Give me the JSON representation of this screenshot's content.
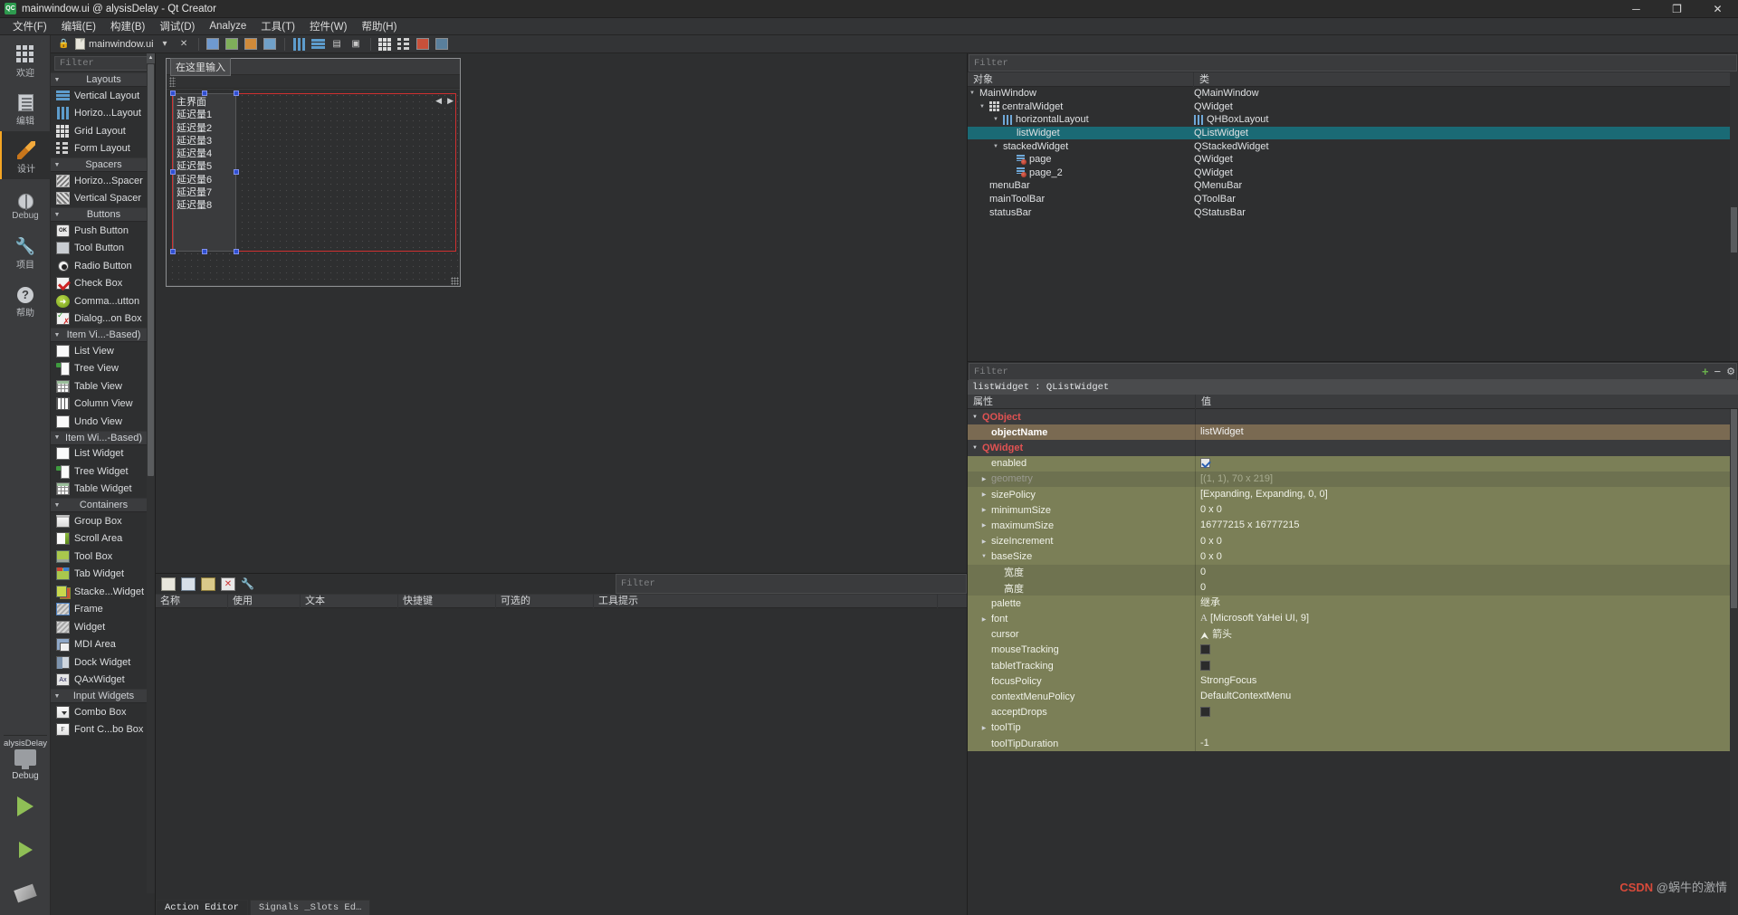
{
  "window": {
    "title": "mainwindow.ui @ alysisDelay - Qt Creator",
    "app_badge": "QC",
    "minimize": "─",
    "maximize": "❐",
    "close": "✕"
  },
  "menubar": [
    {
      "label": "文件(F)"
    },
    {
      "label": "编辑(E)"
    },
    {
      "label": "构建(B)"
    },
    {
      "label": "调试(D)"
    },
    {
      "label": "Analyze"
    },
    {
      "label": "工具(T)"
    },
    {
      "label": "控件(W)"
    },
    {
      "label": "帮助(H)"
    }
  ],
  "modebar": {
    "items": [
      {
        "label": "欢迎",
        "icon": "grid-icon",
        "active": false
      },
      {
        "label": "编辑",
        "icon": "document-icon",
        "active": false
      },
      {
        "label": "设计",
        "icon": "pencil-icon",
        "active": true
      },
      {
        "label": "Debug",
        "icon": "bug-icon",
        "active": false
      },
      {
        "label": "项目",
        "icon": "wrench-icon",
        "active": false
      },
      {
        "label": "帮助",
        "icon": "question-icon",
        "active": false
      }
    ],
    "kit": {
      "project": "alysisDelay",
      "build_config": "Debug"
    }
  },
  "filebar": {
    "filename": "mainwindow.ui"
  },
  "widgetbox": {
    "filter_placeholder": "Filter",
    "groups": [
      {
        "title": "Layouts",
        "items": [
          {
            "label": "Vertical Layout",
            "icon": "vertical-layout-icon"
          },
          {
            "label": "Horizo...Layout",
            "icon": "horizontal-layout-icon"
          },
          {
            "label": "Grid Layout",
            "icon": "grid-layout-icon"
          },
          {
            "label": "Form Layout",
            "icon": "form-layout-icon"
          }
        ]
      },
      {
        "title": "Spacers",
        "items": [
          {
            "label": "Horizo...Spacer",
            "icon": "horizontal-spacer-icon"
          },
          {
            "label": "Vertical Spacer",
            "icon": "vertical-spacer-icon"
          }
        ]
      },
      {
        "title": "Buttons",
        "items": [
          {
            "label": "Push Button",
            "icon": "push-button-icon"
          },
          {
            "label": "Tool Button",
            "icon": "tool-button-icon"
          },
          {
            "label": "Radio Button",
            "icon": "radio-button-icon"
          },
          {
            "label": "Check Box",
            "icon": "check-box-icon"
          },
          {
            "label": "Comma...utton",
            "icon": "command-link-button-icon"
          },
          {
            "label": "Dialog...on Box",
            "icon": "dialog-button-box-icon"
          }
        ]
      },
      {
        "title": "Item Vi...-Based)",
        "items": [
          {
            "label": "List View",
            "icon": "list-view-icon"
          },
          {
            "label": "Tree View",
            "icon": "tree-view-icon"
          },
          {
            "label": "Table View",
            "icon": "table-view-icon"
          },
          {
            "label": "Column View",
            "icon": "column-view-icon"
          },
          {
            "label": "Undo View",
            "icon": "undo-view-icon"
          }
        ]
      },
      {
        "title": "Item Wi...-Based)",
        "items": [
          {
            "label": "List Widget",
            "icon": "list-widget-icon"
          },
          {
            "label": "Tree Widget",
            "icon": "tree-widget-icon"
          },
          {
            "label": "Table Widget",
            "icon": "table-widget-icon"
          }
        ]
      },
      {
        "title": "Containers",
        "items": [
          {
            "label": "Group Box",
            "icon": "group-box-icon"
          },
          {
            "label": "Scroll Area",
            "icon": "scroll-area-icon"
          },
          {
            "label": "Tool Box",
            "icon": "tool-box-icon"
          },
          {
            "label": "Tab Widget",
            "icon": "tab-widget-icon"
          },
          {
            "label": "Stacke...Widget",
            "icon": "stacked-widget-icon"
          },
          {
            "label": "Frame",
            "icon": "frame-icon"
          },
          {
            "label": "Widget",
            "icon": "widget-icon"
          },
          {
            "label": "MDI Area",
            "icon": "mdi-area-icon"
          },
          {
            "label": "Dock Widget",
            "icon": "dock-widget-icon"
          },
          {
            "label": "QAxWidget",
            "icon": "qax-widget-icon"
          }
        ]
      },
      {
        "title": "Input Widgets",
        "items": [
          {
            "label": "Combo Box",
            "icon": "combo-box-icon"
          },
          {
            "label": "Font C...bo Box",
            "icon": "font-combo-box-icon"
          }
        ]
      }
    ]
  },
  "form": {
    "menubar_placeholder": "在这里输入",
    "list_items": [
      "主界面",
      "延迟量1",
      "延迟量2",
      "延迟量3",
      "延迟量4",
      "延迟量5",
      "延迟量6",
      "延迟量7",
      "延迟量8"
    ],
    "stack_prev": "◀",
    "stack_next": "▶"
  },
  "action_editor": {
    "filter_placeholder": "Filter",
    "columns": [
      "名称",
      "使用",
      "文本",
      "快捷键",
      "可选的",
      "工具提示"
    ],
    "tabs": [
      {
        "label": "Action Editor",
        "active": true
      },
      {
        "label": "Signals _Slots Ed…",
        "active": false
      }
    ],
    "toolbar": [
      {
        "icon": "new-action-icon"
      },
      {
        "icon": "copy-icon"
      },
      {
        "icon": "paste-icon"
      },
      {
        "icon": "delete-icon"
      },
      {
        "icon": "settings-wrench-icon"
      }
    ]
  },
  "object_inspector": {
    "filter_placeholder": "Filter",
    "columns": [
      "对象",
      "类"
    ],
    "rows": [
      {
        "name": "MainWindow",
        "class": "QMainWindow",
        "indent": 0,
        "chevron": "down",
        "icon": "",
        "class_icon": "",
        "selected": false
      },
      {
        "name": "centralWidget",
        "class": "QWidget",
        "indent": 1,
        "chevron": "down",
        "icon": "grid-icon",
        "class_icon": "",
        "selected": false
      },
      {
        "name": "horizontalLayout",
        "class": "QHBoxLayout",
        "indent": 2,
        "chevron": "down",
        "icon": "hbox-icon",
        "class_icon": "hbox-icon",
        "selected": false
      },
      {
        "name": "listWidget",
        "class": "QListWidget",
        "indent": 3,
        "chevron": "",
        "icon": "",
        "class_icon": "",
        "selected": true
      },
      {
        "name": "stackedWidget",
        "class": "QStackedWidget",
        "indent": 2,
        "chevron": "down",
        "icon": "",
        "class_icon": "",
        "selected": false
      },
      {
        "name": "page",
        "class": "QWidget",
        "indent": 3,
        "chevron": "",
        "icon": "page-icon",
        "class_icon": "",
        "selected": false
      },
      {
        "name": "page_2",
        "class": "QWidget",
        "indent": 3,
        "chevron": "",
        "icon": "page-icon",
        "class_icon": "",
        "selected": false
      },
      {
        "name": "menuBar",
        "class": "QMenuBar",
        "indent": 1,
        "chevron": "",
        "icon": "",
        "class_icon": "",
        "selected": false
      },
      {
        "name": "mainToolBar",
        "class": "QToolBar",
        "indent": 1,
        "chevron": "",
        "icon": "",
        "class_icon": "",
        "selected": false
      },
      {
        "name": "statusBar",
        "class": "QStatusBar",
        "indent": 1,
        "chevron": "",
        "icon": "",
        "class_icon": "",
        "selected": false
      }
    ]
  },
  "property_editor": {
    "filter_placeholder": "Filter",
    "object_line": "listWidget : QListWidget",
    "columns": [
      "属性",
      "值"
    ],
    "add_label": "+",
    "remove_label": "−",
    "config_label": "⚙",
    "rows": [
      {
        "name": "QObject",
        "value": "",
        "style": "group",
        "chevron": "down",
        "indent": 0
      },
      {
        "name": "objectName",
        "value": "listWidget",
        "style": "brown",
        "chevron": "",
        "indent": 1
      },
      {
        "name": "QWidget",
        "value": "",
        "style": "group",
        "chevron": "down",
        "indent": 0
      },
      {
        "name": "enabled",
        "value": "checkbox",
        "style": "olive",
        "chevron": "",
        "indent": 1
      },
      {
        "name": "geometry",
        "value": "[(1, 1), 70 x 219]",
        "style": "dim",
        "chevron": "right",
        "indent": 1
      },
      {
        "name": "sizePolicy",
        "value": "[Expanding, Expanding, 0, 0]",
        "style": "olive",
        "chevron": "right",
        "indent": 1
      },
      {
        "name": "minimumSize",
        "value": "0 x 0",
        "style": "olive",
        "chevron": "right",
        "indent": 1
      },
      {
        "name": "maximumSize",
        "value": "16777215 x 16777215",
        "style": "olive",
        "chevron": "right",
        "indent": 1
      },
      {
        "name": "sizeIncrement",
        "value": "0 x 0",
        "style": "olive",
        "chevron": "right",
        "indent": 1
      },
      {
        "name": "baseSize",
        "value": "0 x 0",
        "style": "olive",
        "chevron": "down",
        "indent": 1
      },
      {
        "name": "宽度",
        "value": "0",
        "style": "olive2",
        "chevron": "",
        "indent": 2
      },
      {
        "name": "高度",
        "value": "0",
        "style": "olive2",
        "chevron": "",
        "indent": 2
      },
      {
        "name": "palette",
        "value": "继承",
        "style": "olive",
        "chevron": "",
        "indent": 1
      },
      {
        "name": "font",
        "value": "[Microsoft YaHei UI, 9]",
        "style": "olive",
        "chevron": "right",
        "indent": 1,
        "value_icon": "font-A-icon"
      },
      {
        "name": "cursor",
        "value": "箭头",
        "style": "olive",
        "chevron": "",
        "indent": 1,
        "value_icon": "cursor-arrow-icon"
      },
      {
        "name": "mouseTracking",
        "value": "unchecked",
        "style": "olive",
        "chevron": "",
        "indent": 1
      },
      {
        "name": "tabletTracking",
        "value": "unchecked",
        "style": "olive",
        "chevron": "",
        "indent": 1
      },
      {
        "name": "focusPolicy",
        "value": "StrongFocus",
        "style": "olive",
        "chevron": "",
        "indent": 1
      },
      {
        "name": "contextMenuPolicy",
        "value": "DefaultContextMenu",
        "style": "olive",
        "chevron": "",
        "indent": 1
      },
      {
        "name": "acceptDrops",
        "value": "unchecked",
        "style": "olive",
        "chevron": "",
        "indent": 1
      },
      {
        "name": "toolTip",
        "value": "",
        "style": "olive",
        "chevron": "right",
        "indent": 1
      },
      {
        "name": "toolTipDuration",
        "value": "-1",
        "style": "olive",
        "chevron": "",
        "indent": 1
      }
    ]
  },
  "watermark": {
    "logo": "CSDN",
    "text": "@蜗牛的激情"
  }
}
